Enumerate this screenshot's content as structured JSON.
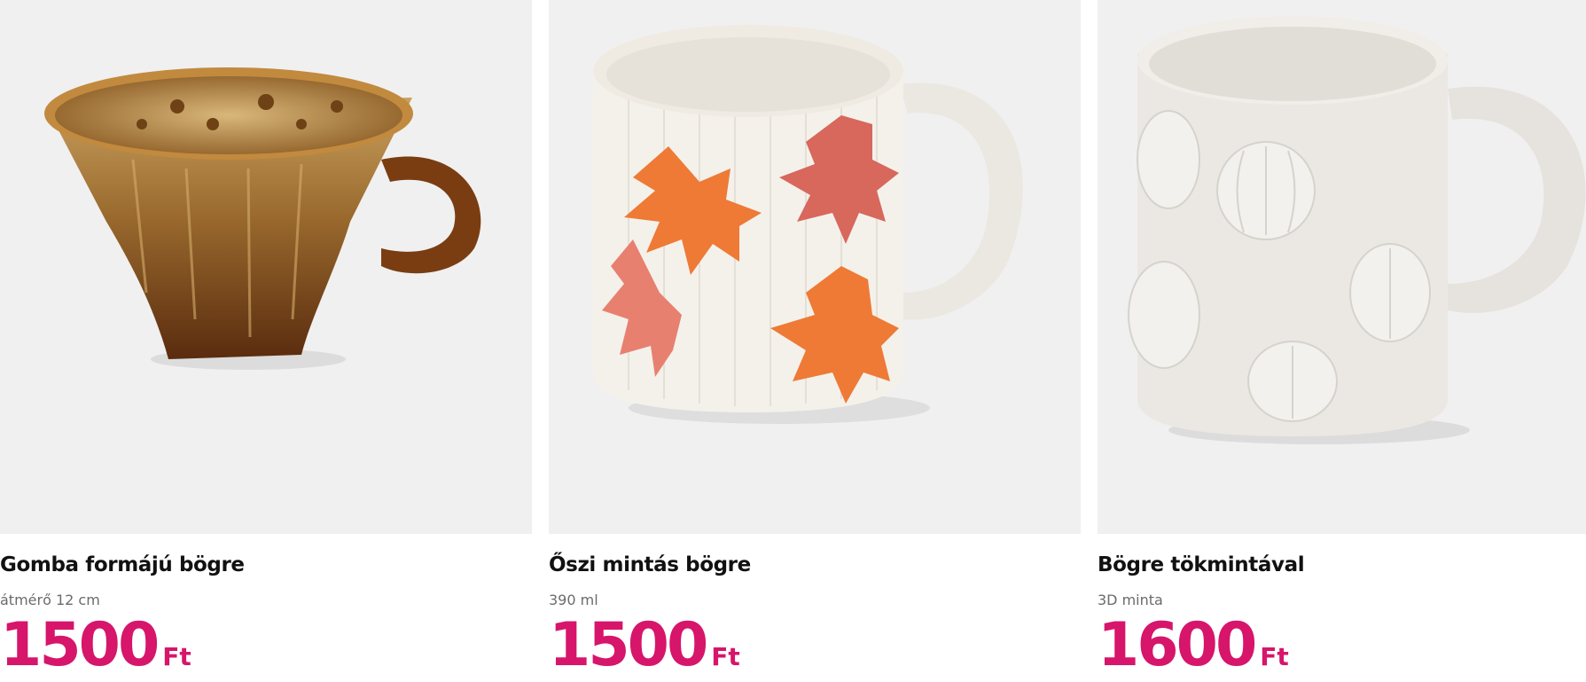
{
  "products": [
    {
      "name": "Gomba formájú bögre",
      "detail": "átmérő 12 cm",
      "price": "1500",
      "currency": "Ft",
      "image_icon": "brown-mushroom-mug-image"
    },
    {
      "name": "Őszi mintás bögre",
      "detail": "390 ml",
      "price": "1500",
      "currency": "Ft",
      "image_icon": "autumn-leaf-mug-image"
    },
    {
      "name": "Bögre tökmintával",
      "detail": "3D minta",
      "price": "1600",
      "currency": "Ft",
      "image_icon": "pumpkin-pattern-mug-image"
    }
  ],
  "colors": {
    "price": "#d6156b",
    "image_background": "#f0f0f0"
  }
}
